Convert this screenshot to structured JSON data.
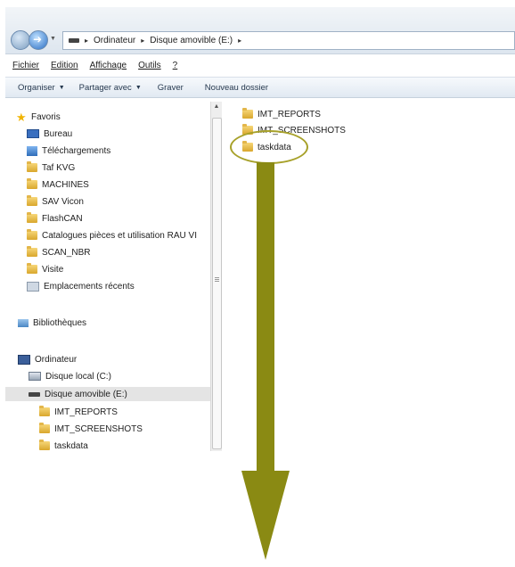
{
  "address_bar": {
    "path": [
      "Ordinateur",
      "Disque amovible (E:)"
    ]
  },
  "menu": [
    "Fichier",
    "Edition",
    "Affichage",
    "Outils",
    "?"
  ],
  "toolbar": {
    "organize": "Organiser",
    "share": "Partager avec",
    "burn": "Graver",
    "new_folder": "Nouveau dossier"
  },
  "nav": {
    "favorites": "Favoris",
    "favorites_items": [
      "Bureau",
      "Téléchargements",
      "Taf KVG",
      "MACHINES",
      "SAV Vicon",
      "FlashCAN",
      "Catalogues pièces et utilisation RAU VI",
      "SCAN_NBR",
      "Visite",
      "Emplacements récents"
    ],
    "libraries": "Bibliothèques",
    "computer": "Ordinateur",
    "local_disk": "Disque local (C:)",
    "removable": "Disque amovible (E:)",
    "removable_children": [
      "IMT_REPORTS",
      "IMT_SCREENSHOTS",
      "taskdata"
    ]
  },
  "files": [
    "IMT_REPORTS",
    "IMT_SCREENSHOTS",
    "taskdata"
  ],
  "icons": {
    "back": "back-arrow-icon",
    "forward": "forward-arrow-icon",
    "folder": "folder-icon",
    "drive": "removable-drive-icon"
  },
  "colors": {
    "annotation": "#8a8a13",
    "ellipse": "#a7a12a"
  }
}
